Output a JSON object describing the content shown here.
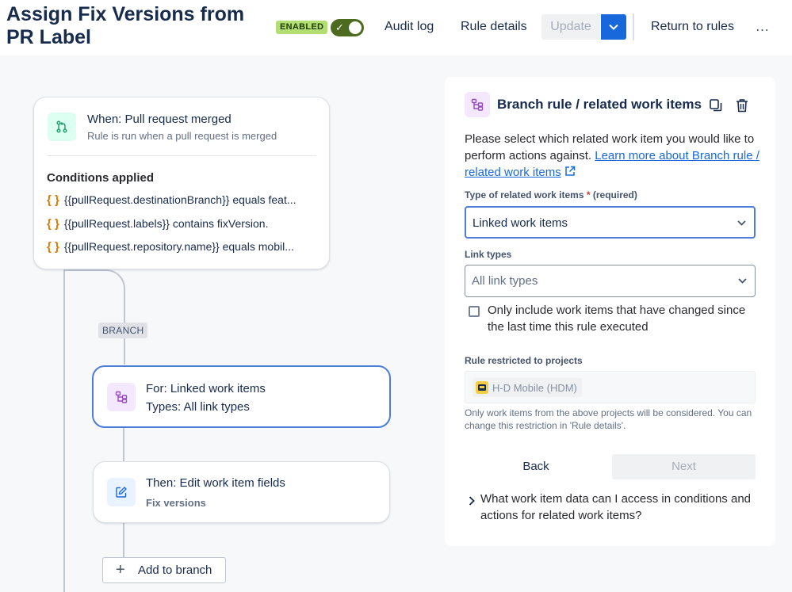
{
  "header": {
    "title": "Assign Fix Versions from PR Label",
    "enabled_badge": "ENABLED",
    "audit_log": "Audit log",
    "rule_details": "Rule details",
    "update": "Update",
    "return_to_rules": "Return to rules",
    "more": "…"
  },
  "trigger": {
    "title": "When: Pull request merged",
    "subtitle": "Rule is run when a pull request is merged",
    "conditions_heading": "Conditions applied",
    "conditions": [
      "{{pullRequest.destinationBranch}} equals feat...",
      "{{pullRequest.labels}} contains fixVersion.",
      "{{pullRequest.repository.name}} equals mobil..."
    ]
  },
  "branch_chip": "BRANCH",
  "for_card": {
    "title": "For: Linked work items",
    "subtitle": "Types: All link types"
  },
  "then_card": {
    "title": "Then: Edit work item fields",
    "subtitle": "Fix versions"
  },
  "add_to_branch": "Add to branch",
  "panel": {
    "title": "Branch rule / related work items",
    "desc_text": "Please select which related work item you would like to perform actions against. ",
    "desc_link": "Learn more about Branch rule / related work items",
    "type_label": "Type of related work items",
    "type_required_star": "*",
    "type_required": "(required)",
    "type_value": "Linked work items",
    "link_types_label": "Link types",
    "link_types_placeholder": "All link types",
    "checkbox_label": "Only include work items that have changed since the last time this rule executed",
    "restricted_label": "Rule restricted to projects",
    "project_chip": "H-D Mobile (HDM)",
    "help_text": "Only work items from the above projects will be considered. You can change this restriction in 'Rule details'.",
    "back": "Back",
    "next": "Next",
    "expander": "What work item data can I access in conditions and actions for related work items?"
  },
  "colors": {
    "accent": "#1868db",
    "enabled_badge": "#b3df72",
    "toggle_on": "#4c6b1f",
    "condition_brace": "#e07800",
    "selected_card_border": "#4c7ddb"
  }
}
